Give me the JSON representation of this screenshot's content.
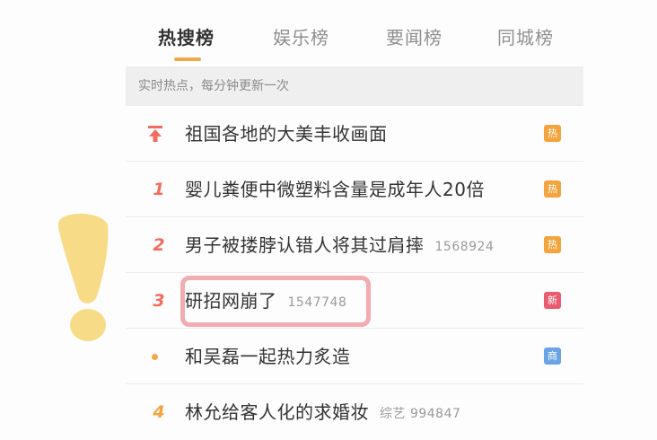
{
  "tabs": [
    {
      "label": "热搜榜",
      "active": true
    },
    {
      "label": "娱乐榜",
      "active": false
    },
    {
      "label": "要闻榜",
      "active": false
    },
    {
      "label": "同城榜",
      "active": false
    }
  ],
  "subheader": "实时热点，每分钟更新一次",
  "rows": [
    {
      "rank": "",
      "icon": "pin-top-icon",
      "title": "祖国各地的大美丰收画面",
      "meta": "",
      "badge": "热",
      "badge_color": "#f4a43c"
    },
    {
      "rank": "1",
      "title": "婴儿粪便中微塑料含量是成年人20倍",
      "meta": "",
      "badge": "热",
      "badge_color": "#f4a43c"
    },
    {
      "rank": "2",
      "title": "男子被搂脖认错人将其过肩摔",
      "meta": "1568924",
      "badge": "热",
      "badge_color": "#f4a43c"
    },
    {
      "rank": "3",
      "title": "研招网崩了",
      "meta": "1547748",
      "badge": "新",
      "badge_color": "#ea5b6f"
    },
    {
      "rank": "",
      "icon": "dot-icon",
      "title": "和吴磊一起热力炙造",
      "meta": "",
      "badge": "商",
      "badge_color": "#6aa4e4"
    },
    {
      "rank": "4",
      "title": "林允给客人化的求婚妆",
      "meta": "综艺 994847",
      "badge": "",
      "badge_color": ""
    }
  ],
  "colors": {
    "accent": "#f0a84a",
    "rank_red": "#f26d5f",
    "rank_orange": "#f4a43c",
    "highlight": "#f1a2a8",
    "exclaim": "#f7d77a"
  }
}
